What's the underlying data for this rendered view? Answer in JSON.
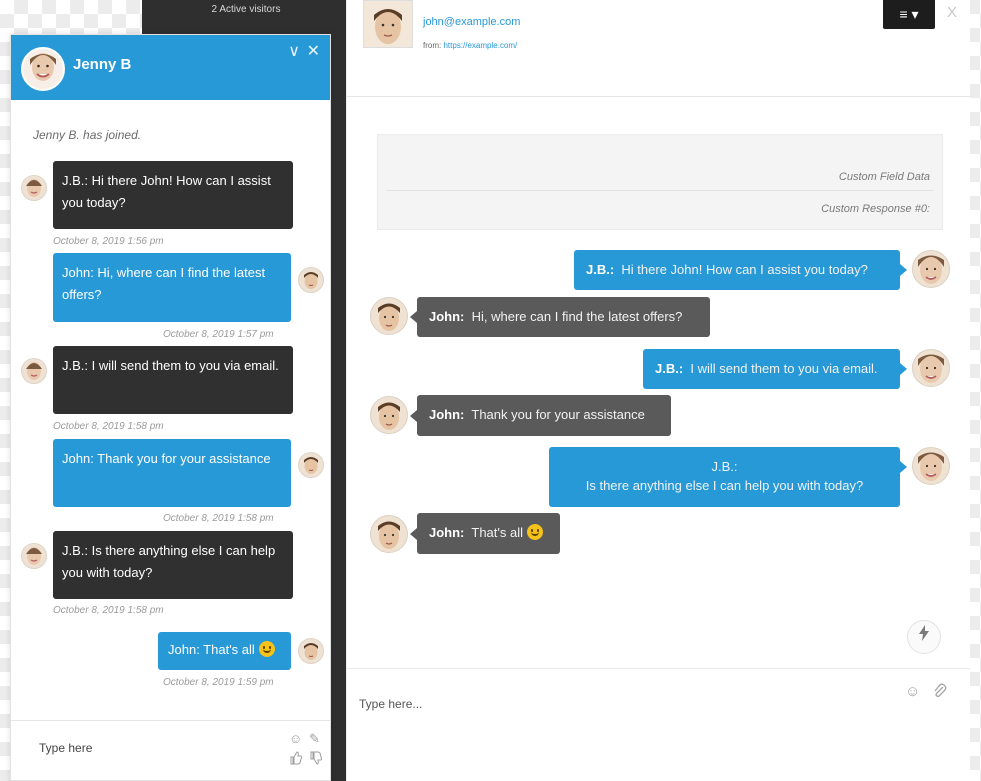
{
  "background_strip": {
    "top_text": "2 Active visitors"
  },
  "widget": {
    "title": "Jenny B",
    "joined_text": "Jenny B. has joined.",
    "minimize_symbol": "∨",
    "close_symbol": "✕",
    "input_placeholder": "Type here",
    "colors": {
      "header": "#2799d7",
      "agent_bubble": "#303030",
      "user_bubble": "#2799d7"
    },
    "messages": [
      {
        "sender": "agent",
        "text": "J.B.:  Hi there John! How can I assist you today?",
        "time": "October 8, 2019 1:56 pm"
      },
      {
        "sender": "user",
        "text": "John: Hi, where can I find the latest offers?",
        "time": "October 8, 2019 1:57 pm"
      },
      {
        "sender": "agent",
        "text": "J.B.:  I will send them to you via email.",
        "time": "October 8, 2019 1:58 pm"
      },
      {
        "sender": "user",
        "text": "John: Thank you for your assistance",
        "time": "October 8, 2019 1:58 pm"
      },
      {
        "sender": "agent",
        "text": "J.B.:  Is there anything else I can help you with today?",
        "time": "October 8, 2019 1:58 pm"
      },
      {
        "sender": "user",
        "text": "John: That's all",
        "time": "October 8, 2019 1:59 pm"
      }
    ]
  },
  "panel": {
    "email": "john@example.com",
    "from_label": "from:",
    "from_url": "https://example.com/",
    "menu_icon": "≡ ▾",
    "close_symbol": "X",
    "custom_field": "Custom Field Data",
    "custom_response": "Custom Response #0:",
    "input_placeholder": "Type here...",
    "colors": {
      "agent_bubble": "#2799d7",
      "user_bubble": "#5a5a5a"
    },
    "messages": [
      {
        "sender": "agent",
        "name": "J.B.:",
        "text": "Hi there John! How can I assist you today?"
      },
      {
        "sender": "user",
        "name": "John:",
        "text": "Hi, where can I find the latest offers?"
      },
      {
        "sender": "agent",
        "name": "J.B.:",
        "text": "I will send them to you via email."
      },
      {
        "sender": "user",
        "name": "John:",
        "text": "Thank you for your assistance"
      },
      {
        "sender": "agent",
        "name": "J.B.:",
        "text": "Is there anything else I can help you with today?"
      },
      {
        "sender": "user",
        "name": "John:",
        "text": "That's all"
      }
    ]
  },
  "icons": {
    "bolt": "⚡",
    "emoji": "☺",
    "attach": "✎",
    "thumbs": "👍"
  }
}
